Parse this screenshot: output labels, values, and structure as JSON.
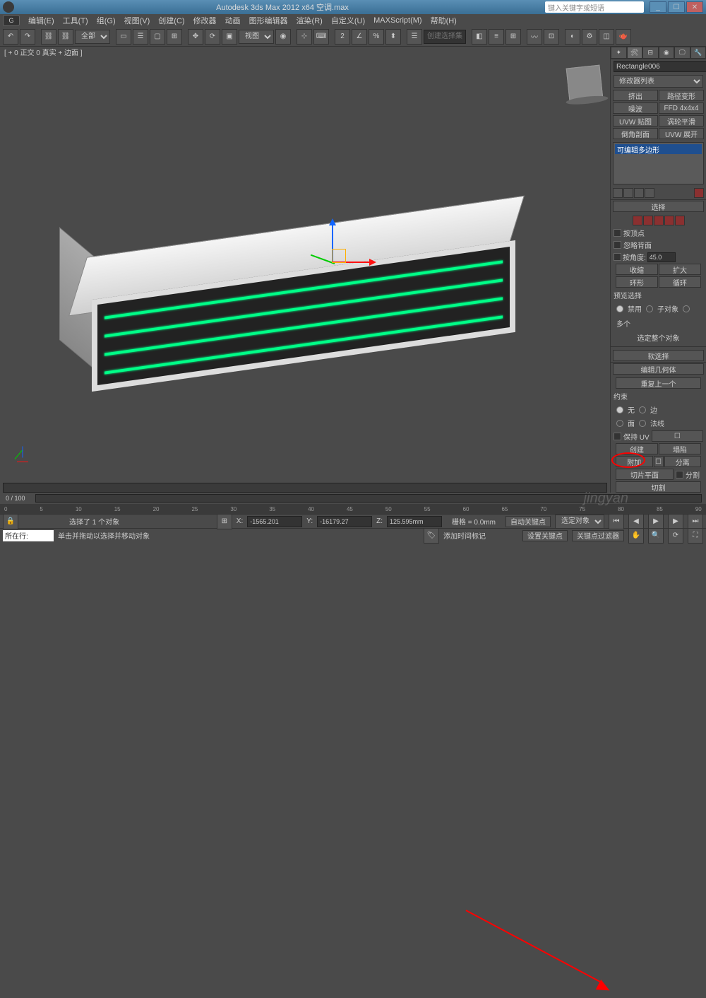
{
  "titlebar": {
    "title": "Autodesk 3ds Max  2012 x64     空调.max",
    "search_placeholder": "键入关键字或短语"
  },
  "menu": {
    "items": [
      "编辑(E)",
      "工具(T)",
      "组(G)",
      "视图(V)",
      "创建(C)",
      "修改器",
      "动画",
      "图形编辑器",
      "渲染(R)",
      "自定义(U)",
      "MAXScript(M)",
      "帮助(H)"
    ]
  },
  "toolbar": {
    "selection_set": "全部",
    "create_sel": "创建选择集"
  },
  "viewport": {
    "label": "[ + 0 正交 0 真实 + 边面 ]"
  },
  "right_panel": {
    "object_name": "Rectangle006",
    "modifier_list": "修改器列表",
    "mod_buttons": [
      "挤出",
      "路径变形",
      "噪波",
      "FFD 4x4x4",
      "UVW 贴图",
      "涡轮平滑",
      "倒角剖面",
      "UVW 展开"
    ],
    "stack_item": "可编辑多边形",
    "rollout_select": "选择",
    "by_vertex": "按顶点",
    "ignore_back": "忽略背面",
    "by_angle": "按角度:",
    "angle_val": "45.0",
    "shrink": "收缩",
    "grow": "扩大",
    "ring": "环形",
    "loop": "循环",
    "preview_sel": "预览选择",
    "disable": "禁用",
    "subobj": "子对象",
    "multi": "多个",
    "select_whole": "选定整个对象",
    "rollout_soft": "软选择",
    "rollout_edit": "编辑几何体",
    "repeat_last": "重复上一个",
    "constraint": "约束",
    "c_none": "无",
    "c_edge": "边",
    "c_face": "面",
    "c_normal": "法线",
    "preserve_uv": "保持 UV",
    "create": "创建",
    "collapse": "塌陷",
    "attach": "附加",
    "detach": "分离",
    "slice_plane": "切片平面",
    "split": "分割",
    "cut": "切割"
  },
  "timeline": {
    "range": "0 / 100",
    "ticks": [
      "0",
      "5",
      "10",
      "15",
      "20",
      "25",
      "30",
      "35",
      "40",
      "45",
      "50",
      "55",
      "60",
      "65",
      "70",
      "75",
      "80",
      "85",
      "90"
    ]
  },
  "status": {
    "selected": "选择了 1 个对象",
    "x_label": "X:",
    "x_val": "-1565.201",
    "y_label": "Y:",
    "y_val": "-16179.27",
    "z_label": "Z:",
    "z_val": "125.595mm",
    "grid": "栅格 = 0.0mm",
    "auto_key": "自动关键点",
    "sel_obj": "选定对象",
    "tag_line": "所在行:",
    "hint": "单击并拖动以选择并移动对象",
    "add_time": "添加时间标记",
    "set_key": "设置关键点",
    "key_filter": "关键点过滤器"
  }
}
